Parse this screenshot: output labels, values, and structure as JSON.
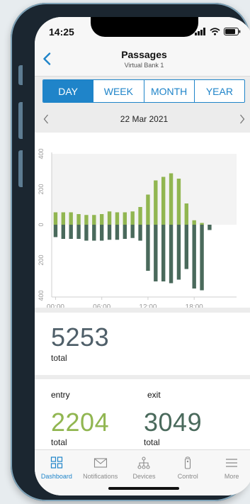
{
  "status_bar": {
    "time": "14:25"
  },
  "header": {
    "title": "Passages",
    "subtitle": "Virtual Bank 1",
    "back_icon": "chevron-left-icon"
  },
  "period_tabs": [
    {
      "label": "DAY",
      "active": true
    },
    {
      "label": "WEEK",
      "active": false
    },
    {
      "label": "MONTH",
      "active": false
    },
    {
      "label": "YEAR",
      "active": false
    }
  ],
  "date_nav": {
    "date": "22 Mar 2021",
    "prev_icon": "chevron-left-icon",
    "next_icon": "chevron-right-icon"
  },
  "colors": {
    "accent": "#1f84c9",
    "entry": "#91b651",
    "exit": "#4a6a5c",
    "number": "#4f5f69"
  },
  "chart_data": {
    "type": "bar",
    "x_tick_labels": [
      "00:00",
      "06:00",
      "12:00",
      "18:00"
    ],
    "y_tick_labels": [
      "400",
      "200",
      "0",
      "200",
      "400"
    ],
    "y_range": [
      -400,
      400
    ],
    "hours": [
      0,
      1,
      2,
      3,
      4,
      5,
      6,
      7,
      8,
      9,
      10,
      11,
      12,
      13,
      14,
      15,
      16,
      17,
      18,
      19,
      20,
      21,
      22,
      23
    ],
    "series": [
      {
        "key": "entry",
        "values": [
          70,
          70,
          70,
          60,
          55,
          55,
          60,
          75,
          70,
          70,
          75,
          100,
          170,
          250,
          270,
          290,
          260,
          120,
          25,
          10,
          0,
          0,
          0,
          0
        ]
      },
      {
        "key": "exit",
        "values": [
          70,
          80,
          80,
          80,
          90,
          90,
          90,
          85,
          85,
          80,
          75,
          90,
          260,
          320,
          320,
          330,
          310,
          250,
          360,
          370,
          30,
          0,
          0,
          0
        ]
      }
    ]
  },
  "totals": {
    "total_value": "5253",
    "total_label": "total",
    "entry_heading": "entry",
    "entry_value": "2204",
    "entry_label": "total",
    "exit_heading": "exit",
    "exit_value": "3049",
    "exit_label": "total"
  },
  "tab_bar": [
    {
      "label": "Dashboard",
      "icon": "dashboard-icon",
      "active": true
    },
    {
      "label": "Notifications",
      "icon": "envelope-icon",
      "active": false
    },
    {
      "label": "Devices",
      "icon": "network-icon",
      "active": false
    },
    {
      "label": "Control",
      "icon": "remote-control-icon",
      "active": false
    },
    {
      "label": "More",
      "icon": "menu-icon",
      "active": false
    }
  ]
}
